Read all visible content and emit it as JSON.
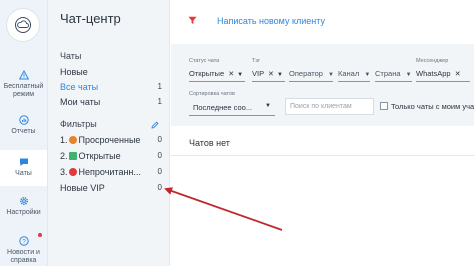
{
  "sidebar": {
    "items": [
      {
        "label": "Бесплатный режим",
        "icon": "warning-triangle-icon"
      },
      {
        "label": "Отчеты",
        "icon": "chart-icon"
      },
      {
        "label": "Чаты",
        "icon": "chat-bubble-icon",
        "active": true
      },
      {
        "label": "Настройки",
        "icon": "gear-icon"
      },
      {
        "label": "Новости и справка",
        "icon": "help-circle-icon"
      }
    ]
  },
  "panel": {
    "title": "Чат-центр",
    "chats_section": "Чаты",
    "chats": [
      {
        "label": "Новые",
        "count": ""
      },
      {
        "label": "Все чаты",
        "count": "1"
      },
      {
        "label": "Мои чаты",
        "count": "1"
      }
    ],
    "filters_section": "Фильтры",
    "filters": [
      {
        "prefix": "1.",
        "label": "Просроченные",
        "count": "0",
        "badge_color": "#e8832a"
      },
      {
        "prefix": "2.",
        "label": "Открытые",
        "count": "0",
        "badge_color": "#3cb371"
      },
      {
        "prefix": "3.",
        "label": "Непрочитанн...",
        "count": "0",
        "badge_color": "#e0393e"
      },
      {
        "prefix": "",
        "label": "Новые VIP",
        "count": "0"
      }
    ]
  },
  "main": {
    "new_message": "Написать новому клиенту",
    "filters": {
      "status": {
        "label": "Статус чата",
        "value": "Открытые"
      },
      "tag": {
        "label": "Тэг",
        "value": "VIP"
      },
      "operator": {
        "placeholder": "Оператор"
      },
      "channel": {
        "placeholder": "Канал"
      },
      "country": {
        "placeholder": "Страна"
      },
      "messenger": {
        "label": "Мессенджер",
        "value": "WhatsApp"
      }
    },
    "sort": {
      "label": "Сортировка чатов",
      "value": "Последнее соо..."
    },
    "search": {
      "placeholder": "Поиск по клиентам"
    },
    "only_mine": "Только чаты с моим участ",
    "empty": "Чатов нет"
  },
  "colors": {
    "accent": "#2e86de",
    "arrow": "#c0282d",
    "rail_bg": "#eef3f9",
    "panel_bg": "#f2f5f8"
  }
}
